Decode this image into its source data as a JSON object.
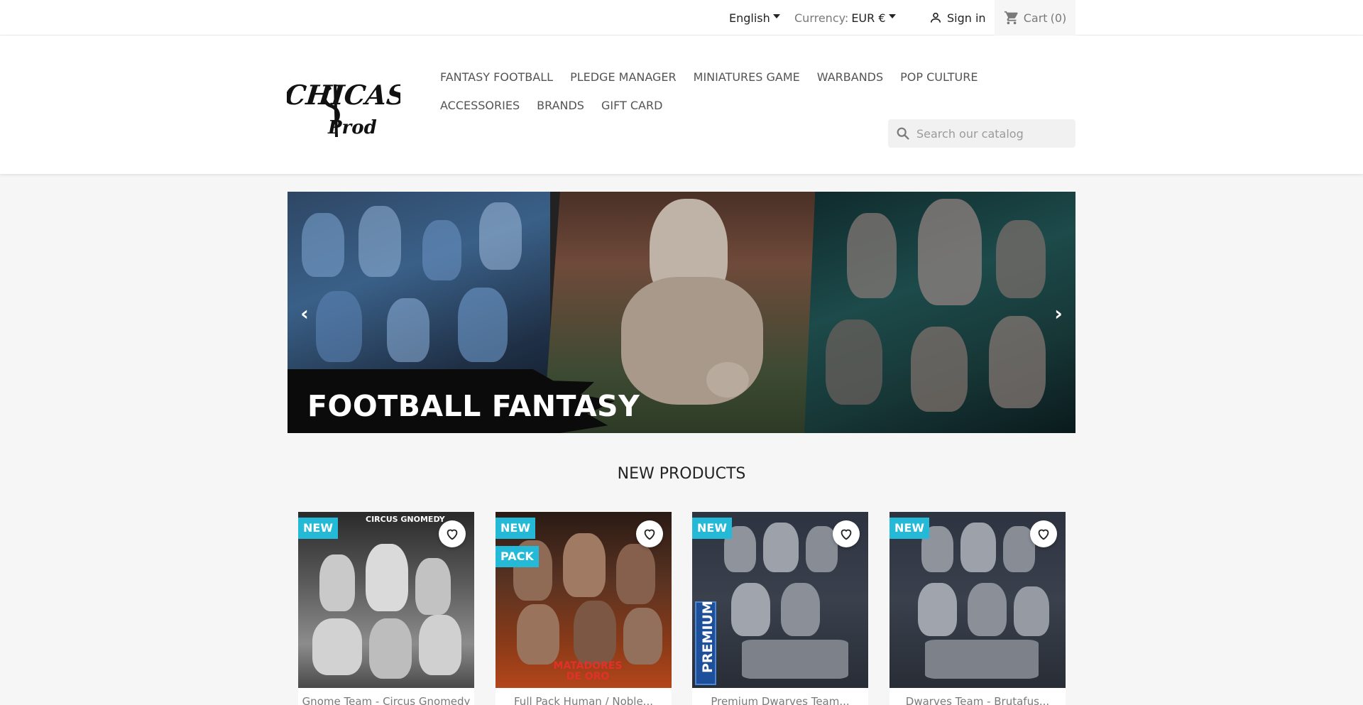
{
  "topbar": {
    "language": "English",
    "currency_label": "Currency:",
    "currency_value": "EUR €",
    "sign_in": "Sign in",
    "cart_label": "Cart",
    "cart_count": "(0)"
  },
  "logo": {
    "alt": "Chicast Prod"
  },
  "nav": {
    "row1": [
      "FANTASY FOOTBALL",
      "PLEDGE MANAGER",
      "MINIATURES GAME",
      "WARBANDS",
      "POP CULTURE"
    ],
    "row2": [
      "ACCESSORIES",
      "BRANDS",
      "GIFT CARD"
    ]
  },
  "search": {
    "placeholder": "Search our catalog"
  },
  "carousel": {
    "title": "FOOTBALL FANTASY"
  },
  "section": {
    "title": "NEW PRODUCTS"
  },
  "products": [
    {
      "badges": [
        "NEW"
      ],
      "name": "Gnome Team - Circus Gnomedy",
      "image_text_top": "CIRCUS GNOMEDY"
    },
    {
      "badges": [
        "NEW",
        "PACK"
      ],
      "name": "Full Pack Human / Noble...",
      "image_text_bottom": "MATADORES DE ORO"
    },
    {
      "badges": [
        "NEW"
      ],
      "name": "Premium Dwarves Team...",
      "image_text_side": "PREMIUM"
    },
    {
      "badges": [
        "NEW"
      ],
      "name": "Dwarves Team - Brutafus..."
    }
  ],
  "colors": {
    "badge": "#24b9d7",
    "nav_text": "#545454",
    "background": "#f6f6f6"
  },
  "icons": {
    "user": "user-icon",
    "cart": "cart-icon",
    "search": "search-icon",
    "wishlist": "heart-icon"
  }
}
